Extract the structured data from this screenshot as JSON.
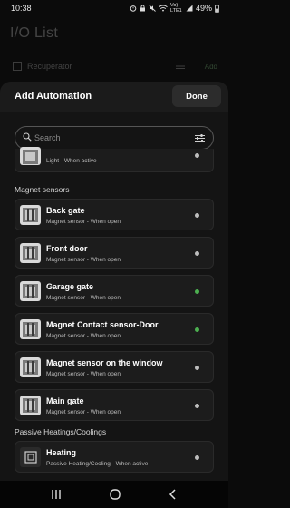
{
  "status_bar": {
    "time": "10:38",
    "battery": "49%",
    "network": "Vo) LTE1"
  },
  "background_page": {
    "title": "I/O List",
    "row_label": "Recuperator",
    "row_action": "Add"
  },
  "sheet": {
    "title": "Add Automation",
    "done_label": "Done",
    "search_placeholder": "Search"
  },
  "partial_item": {
    "subtitle": "Light - When active"
  },
  "sections": [
    {
      "label": "Magnet sensors",
      "items": [
        {
          "name": "Back gate",
          "subtitle": "Magnet sensor - When open",
          "status": "gray"
        },
        {
          "name": "Front door",
          "subtitle": "Magnet sensor - When open",
          "status": "gray"
        },
        {
          "name": "Garage gate",
          "subtitle": "Magnet sensor - When open",
          "status": "green"
        },
        {
          "name": "Magnet Contact sensor-Door",
          "subtitle": "Magnet sensor - When open",
          "status": "green"
        },
        {
          "name": "Magnet sensor on the window",
          "subtitle": "Magnet sensor - When open",
          "status": "gray"
        },
        {
          "name": "Main gate",
          "subtitle": "Magnet sensor - When open",
          "status": "gray"
        }
      ]
    },
    {
      "label": "Passive Heatings/Coolings",
      "items": [
        {
          "name": "Heating",
          "subtitle": "Passive Heating/Cooling - When active",
          "status": "gray"
        }
      ]
    }
  ],
  "colors": {
    "status_green": "#4caf50",
    "status_gray": "#bdbdbd",
    "sheet_bg": "#141414",
    "card_bg": "#1c1c1c"
  },
  "icons": {
    "search": "search-icon",
    "filter": "sliders-icon",
    "nav_recents": "recents-icon",
    "nav_home": "home-icon",
    "nav_back": "back-icon"
  }
}
